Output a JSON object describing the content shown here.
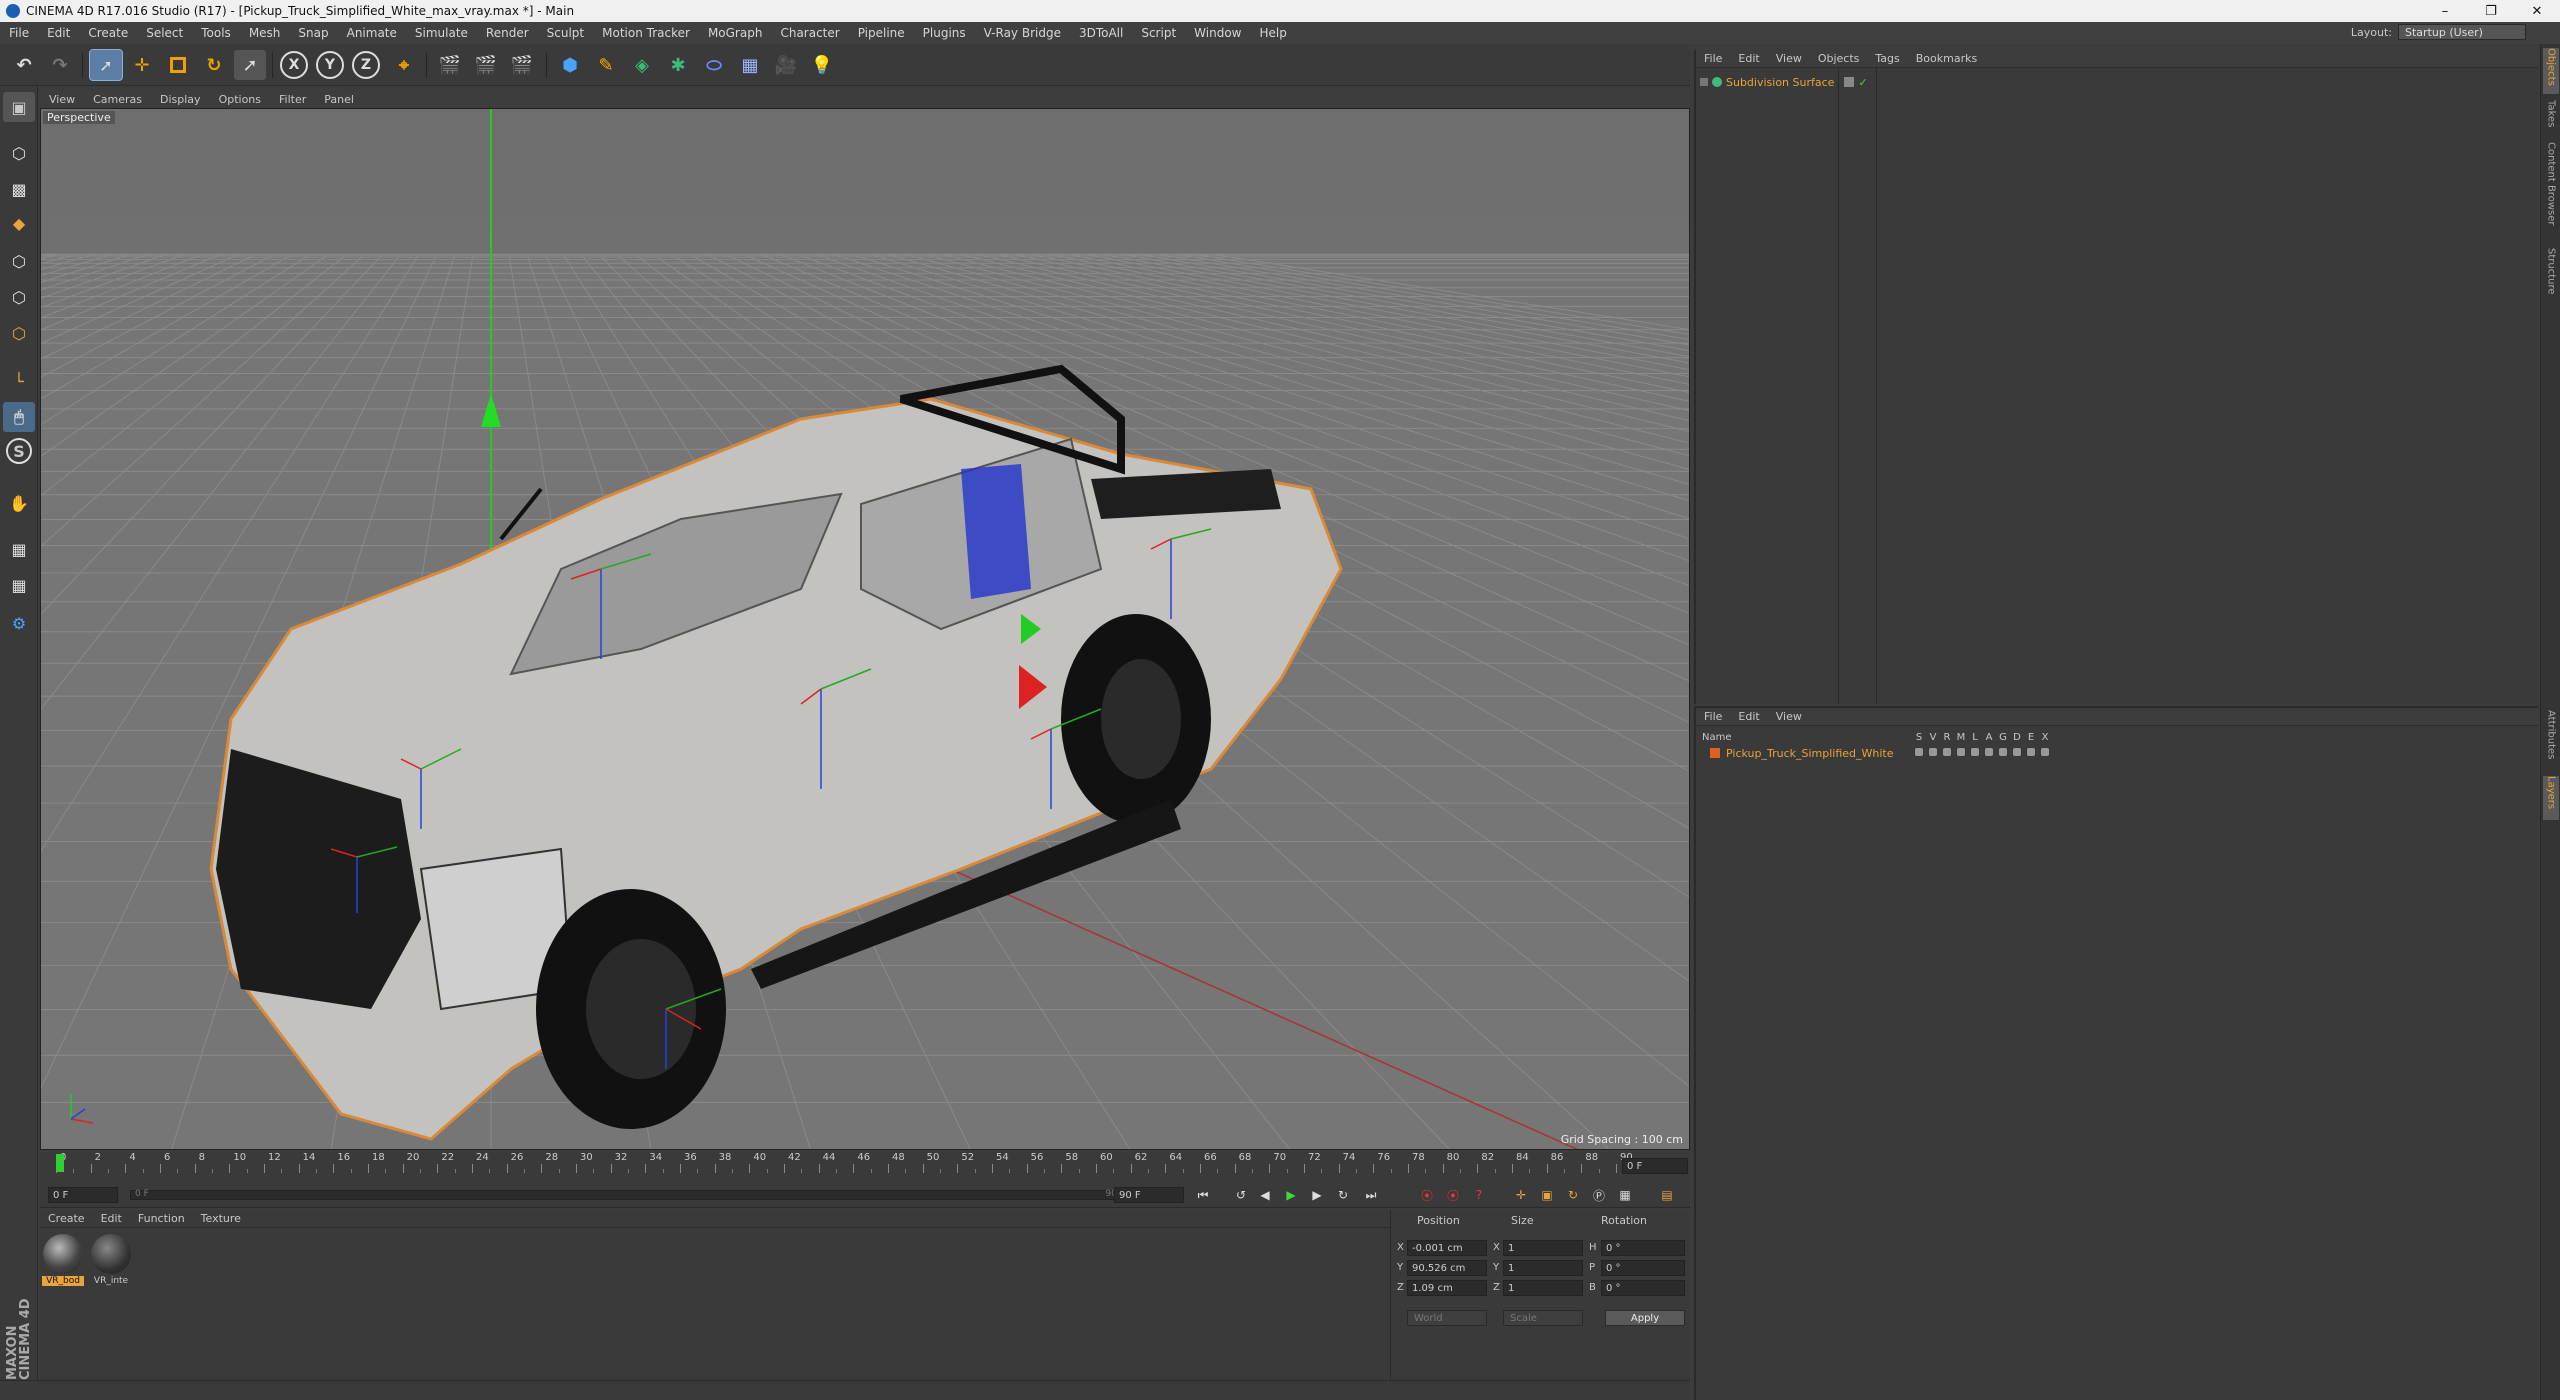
{
  "titlebar": {
    "title": "CINEMA 4D R17.016 Studio (R17) - [Pickup_Truck_Simplified_White_max_vray.max *] - Main",
    "minimize": "–",
    "restore": "❐",
    "close": "✕"
  },
  "menubar": {
    "items": [
      "File",
      "Edit",
      "Create",
      "Select",
      "Tools",
      "Mesh",
      "Snap",
      "Animate",
      "Simulate",
      "Render",
      "Sculpt",
      "Motion Tracker",
      "MoGraph",
      "Character",
      "Pipeline",
      "Plugins",
      "V-Ray Bridge",
      "3DToAll",
      "Script",
      "Window",
      "Help"
    ],
    "layout_label": "Layout:",
    "layout_value": "Startup (User)"
  },
  "toolbar": {
    "axes": [
      "X",
      "Y",
      "Z"
    ]
  },
  "viewport": {
    "menu": [
      "View",
      "Cameras",
      "Display",
      "Options",
      "Filter",
      "Panel"
    ],
    "camera_label": "Perspective",
    "grid_spacing": "Grid Spacing : 100 cm"
  },
  "timeline": {
    "ticks": [
      "0",
      "2",
      "4",
      "6",
      "8",
      "10",
      "12",
      "14",
      "16",
      "18",
      "20",
      "22",
      "24",
      "26",
      "28",
      "30",
      "32",
      "34",
      "36",
      "38",
      "40",
      "42",
      "44",
      "46",
      "48",
      "50",
      "52",
      "54",
      "56",
      "58",
      "60",
      "62",
      "64",
      "66",
      "68",
      "70",
      "72",
      "74",
      "76",
      "78",
      "80",
      "82",
      "84",
      "86",
      "88",
      "90"
    ],
    "current_frame": "0 F",
    "start_field": "0 F",
    "slider_start": "0 F",
    "slider_end": "90 F",
    "end_field": "90 F"
  },
  "materials": {
    "menu": [
      "Create",
      "Edit",
      "Function",
      "Texture"
    ],
    "items": [
      {
        "name": "VR_bod",
        "selected": true
      },
      {
        "name": "VR_inte",
        "selected": false
      }
    ]
  },
  "coordinates": {
    "headers": {
      "position": "Position",
      "size": "Size",
      "rotation": "Rotation"
    },
    "rows": [
      {
        "axis": "X",
        "position": "-0.001 cm",
        "size_axis": "X",
        "size": "1",
        "rot_axis": "H",
        "rotation": "0 °"
      },
      {
        "axis": "Y",
        "position": "90.526 cm",
        "size_axis": "Y",
        "size": "1",
        "rot_axis": "P",
        "rotation": "0 °"
      },
      {
        "axis": "Z",
        "position": "1.09 cm",
        "size_axis": "Z",
        "size": "1",
        "rot_axis": "B",
        "rotation": "0 °"
      }
    ],
    "mode": "World",
    "size_mode": "Scale",
    "apply": "Apply"
  },
  "objects": {
    "menu": [
      "File",
      "Edit",
      "View",
      "Objects",
      "Tags",
      "Bookmarks"
    ],
    "items": [
      {
        "name": "Subdivision Surface"
      }
    ]
  },
  "layers": {
    "menu": [
      "File",
      "Edit",
      "View"
    ],
    "name_header": "Name",
    "columns": [
      "S",
      "V",
      "R",
      "M",
      "L",
      "A",
      "G",
      "D",
      "E",
      "X"
    ],
    "items": [
      {
        "name": "Pickup_Truck_Simplified_White",
        "color": "#e06020"
      }
    ]
  },
  "side_tabs": {
    "top": [
      "Objects",
      "Takes",
      "Content Browser",
      "Structure"
    ],
    "bottom": [
      "Attributes",
      "Layers"
    ]
  },
  "brand": {
    "text": "MAXON CINEMA 4D"
  },
  "colors": {
    "accent": "#e9a43a",
    "selection": "#5b7da6",
    "y_axis": "#22cc22",
    "x_axis": "#dd2222",
    "z_axis": "#2244dd"
  }
}
